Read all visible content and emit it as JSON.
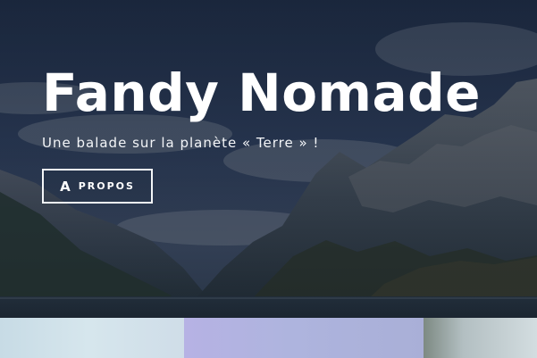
{
  "hero": {
    "title": "Fandy Nomade",
    "tagline": "Une balade sur la planète « Terre » !",
    "button": {
      "first_letter": "A",
      "rest": "propos"
    }
  },
  "thumbnails": [
    {
      "name": "thumbnail-1"
    },
    {
      "name": "thumbnail-2"
    },
    {
      "name": "thumbnail-3"
    }
  ],
  "colors": {
    "hero_overlay": "#213049",
    "text": "#ffffff",
    "button_border": "#f4f6f8"
  }
}
